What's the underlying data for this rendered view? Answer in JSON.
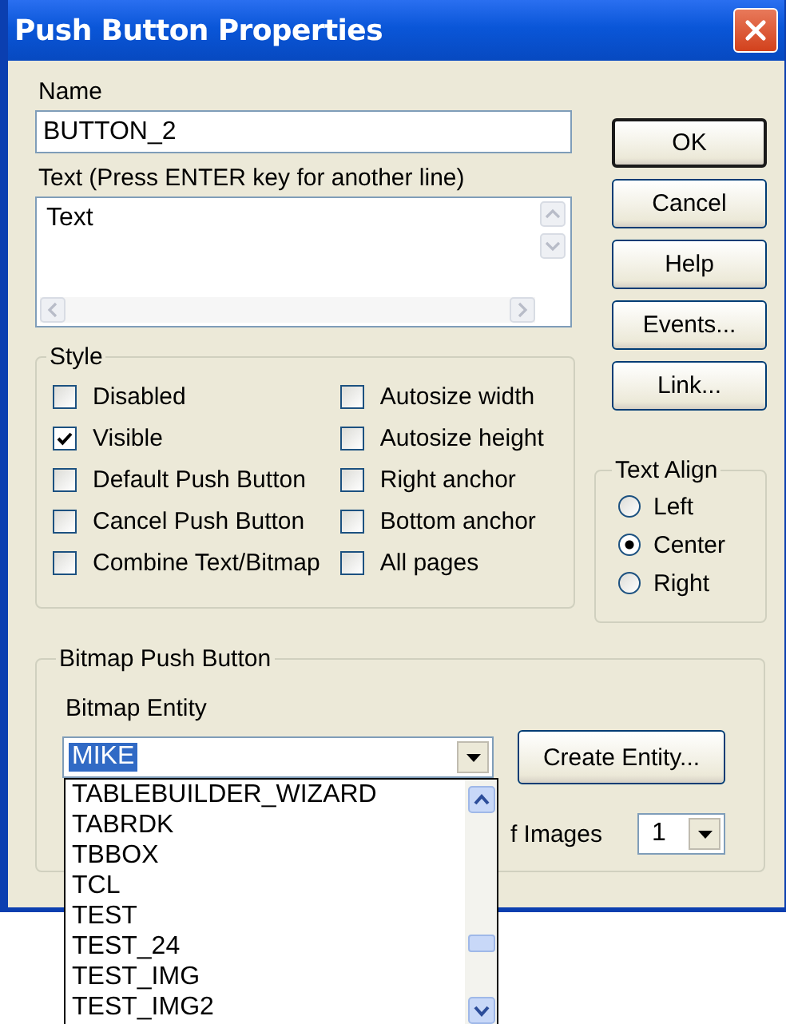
{
  "window": {
    "title": "Push Button Properties"
  },
  "name": {
    "label": "Name",
    "value": "BUTTON_2"
  },
  "text": {
    "label": "Text (Press ENTER key for another line)",
    "value": "Text"
  },
  "buttons": [
    {
      "label": "OK",
      "default": true
    },
    {
      "label": "Cancel",
      "default": false
    },
    {
      "label": "Help",
      "default": false
    },
    {
      "label": "Events...",
      "default": false
    },
    {
      "label": "Link...",
      "default": false
    }
  ],
  "style": {
    "title": "Style",
    "options": [
      {
        "label": "Disabled",
        "checked": false
      },
      {
        "label": "Autosize width",
        "checked": false
      },
      {
        "label": "Visible",
        "checked": true
      },
      {
        "label": "Autosize height",
        "checked": false
      },
      {
        "label": "Default Push Button",
        "checked": false
      },
      {
        "label": "Right anchor",
        "checked": false
      },
      {
        "label": "Cancel Push Button",
        "checked": false
      },
      {
        "label": "Bottom anchor",
        "checked": false
      },
      {
        "label": "Combine Text/Bitmap",
        "checked": false
      },
      {
        "label": "All pages",
        "checked": false
      }
    ]
  },
  "text_align": {
    "title": "Text Align",
    "options": [
      {
        "label": "Left",
        "selected": false
      },
      {
        "label": "Center",
        "selected": true
      },
      {
        "label": "Right",
        "selected": false
      }
    ]
  },
  "bitmap": {
    "title": "Bitmap Push Button",
    "entity_label": "Bitmap Entity",
    "entity_value": "MIKE",
    "entity_value_selected": true,
    "create_button": "Create Entity...",
    "images_label": "f Images",
    "images_value": "1",
    "list": [
      "TABLEBUILDER_WIZARD",
      "TABRDK",
      "TBBOX",
      "TCL",
      "TEST",
      "TEST_24",
      "TEST_IMG",
      "TEST_IMG2"
    ]
  }
}
